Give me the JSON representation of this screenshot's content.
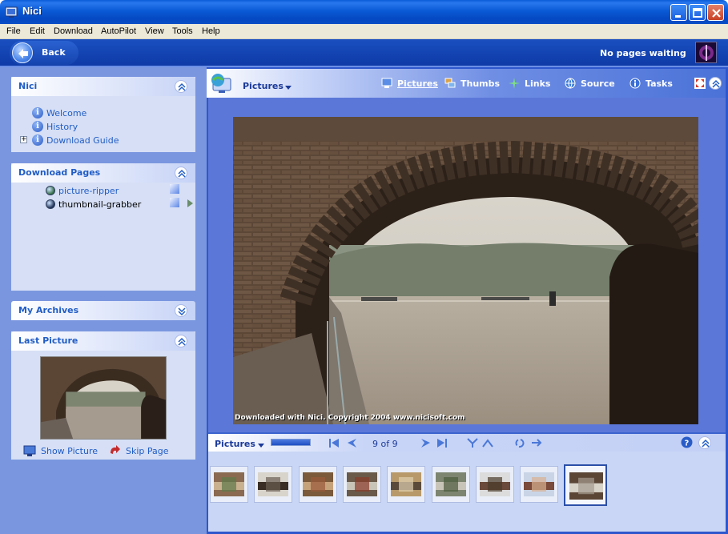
{
  "window": {
    "title": "Nici"
  },
  "menu": [
    "File",
    "Edit",
    "Download",
    "AutoPilot",
    "View",
    "Tools",
    "Help"
  ],
  "toolbar": {
    "back_label": "Back",
    "status": "No pages waiting"
  },
  "sidebar": {
    "nici": {
      "title": "Nici",
      "links": [
        "Welcome",
        "History",
        "Download Guide"
      ]
    },
    "download_pages": {
      "title": "Download Pages",
      "items": [
        "picture-ripper",
        "thumbnail-grabber"
      ]
    },
    "archives": {
      "title": "My Archives"
    },
    "last_picture": {
      "title": "Last Picture",
      "show_label": "Show Picture",
      "skip_label": "Skip Page"
    }
  },
  "view": {
    "current": "Pictures",
    "tabs": [
      "Pictures",
      "Thumbs",
      "Links",
      "Source",
      "Tasks"
    ],
    "watermark": "Downloaded with Nici. Copyright 2004 www.nicisoft.com"
  },
  "filmstrip": {
    "label": "Pictures",
    "position": "9 of 9",
    "progress_fraction": 1.0,
    "thumb_count": 9,
    "selected_index": 8
  },
  "colors": {
    "title_bar": "#0a5ad6",
    "accent_link": "#215dc6",
    "sidebar_bg": "#7a96df",
    "content_bg": "#2e57cd"
  },
  "icons": {
    "app": "app-icon",
    "back": "back-arrow-icon",
    "tabs": [
      "monitor-picture-icon",
      "thumbs-stack-icon",
      "links-sparkle-icon",
      "source-globe-icon",
      "info-icon"
    ]
  }
}
